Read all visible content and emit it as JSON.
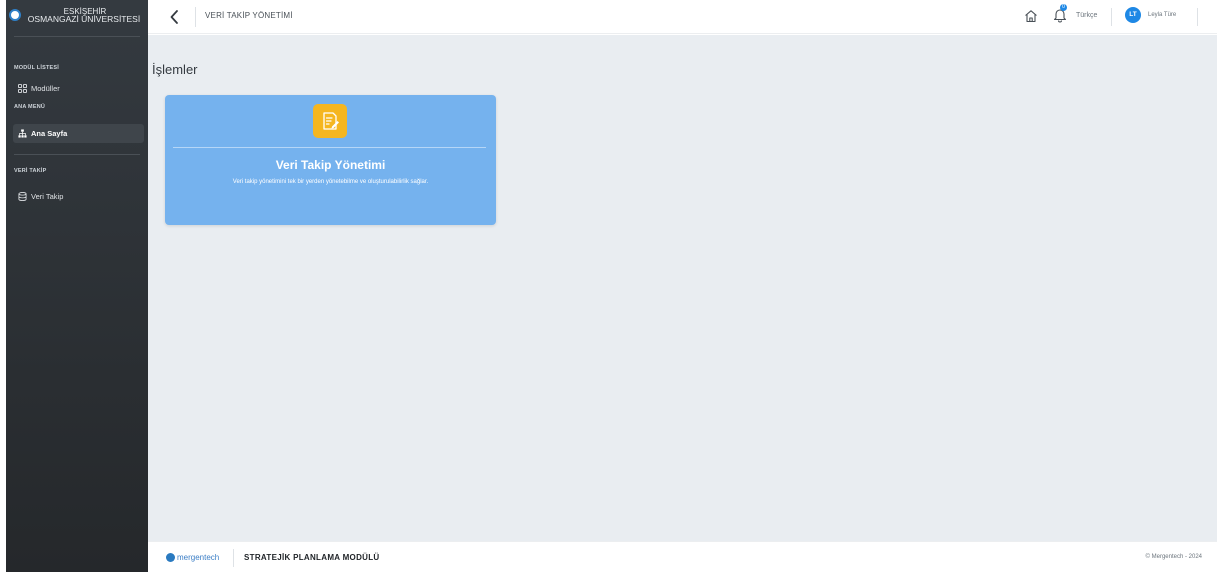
{
  "brand": {
    "line1": "ESKİŞEHİR",
    "line2": "OSMANGAZİ ÜNİVERSİTESİ"
  },
  "sidebar": {
    "sections": [
      {
        "title": "MODÜL LİSTESİ",
        "items": [
          {
            "label": "Modüller",
            "icon": "grid-icon"
          }
        ]
      },
      {
        "title": "ANA MENÜ",
        "items": [
          {
            "label": "Ana Sayfa",
            "icon": "sitemap-icon",
            "active": true
          }
        ]
      },
      {
        "title": "VERİ TAKİP",
        "items": [
          {
            "label": "Veri Takip",
            "icon": "database-icon"
          }
        ]
      }
    ]
  },
  "header": {
    "title": "VERİ TAKİP YÖNETİMİ",
    "notification_count": "0",
    "language": "Türkçe",
    "user_initials": "LT",
    "user_name": "Leyla Türe"
  },
  "main": {
    "section_title": "İşlemler",
    "cards": [
      {
        "title": "Veri Takip Yönetimi",
        "description": "Veri takip yönetimini tek bir yerden yönetebilme ve oluşturulabilirlik sağlar.",
        "icon": "document-edit-icon",
        "color": "#75b2ee",
        "icon_color": "#f5b620"
      }
    ]
  },
  "footer": {
    "brand": "mergentech",
    "module_name": "STRATEJİK PLANLAMA MODÜLÜ",
    "copyright": "© Mergentech - 2024"
  },
  "colors": {
    "sidebar_bg": "#343a40",
    "content_bg": "#e9edf1",
    "accent": "#1e88e5"
  }
}
